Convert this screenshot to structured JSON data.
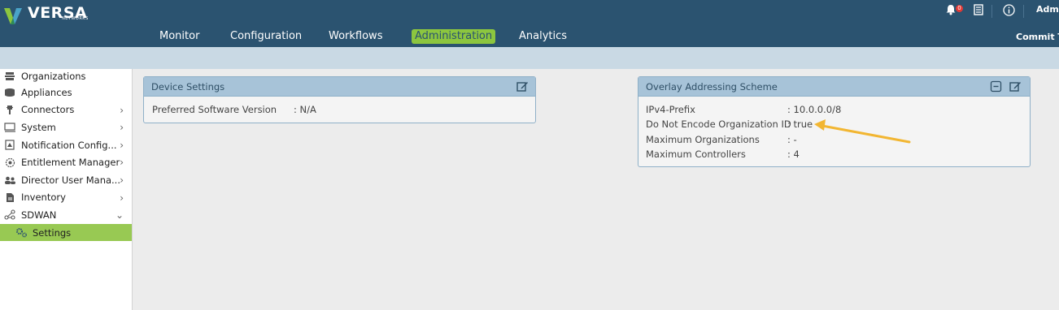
{
  "header": {
    "logo_text": "VERSA",
    "logo_subtext": "NETWORKS",
    "nav": [
      "Monitor",
      "Configuration",
      "Workflows",
      "Administration",
      "Analytics"
    ],
    "active_nav": "Administration",
    "notification_count": "0",
    "user_label": "Admi",
    "commit_label": "Commit Te"
  },
  "sidebar": {
    "items": [
      {
        "label": "Organizations",
        "icon": "organizations-icon"
      },
      {
        "label": "Appliances",
        "icon": "appliances-icon"
      },
      {
        "label": "Connectors",
        "icon": "connectors-icon",
        "expandable": true
      },
      {
        "label": "System",
        "icon": "system-icon",
        "expandable": true
      },
      {
        "label": "Notification Config...",
        "icon": "notification-icon",
        "expandable": true
      },
      {
        "label": "Entitlement Manager",
        "icon": "entitlement-icon",
        "expandable": true
      },
      {
        "label": "Director User Mana...",
        "icon": "users-icon",
        "expandable": true
      },
      {
        "label": "Inventory",
        "icon": "inventory-icon",
        "expandable": true
      },
      {
        "label": "SDWAN",
        "icon": "sdwan-icon",
        "expanded": true
      },
      {
        "label": "Settings",
        "icon": "settings-icon",
        "active": true
      }
    ]
  },
  "device_settings": {
    "title": "Device Settings",
    "rows": [
      {
        "label": "Preferred Software Version",
        "value": ": N/A"
      }
    ]
  },
  "overlay": {
    "title": "Overlay Addressing Scheme",
    "rows": [
      {
        "label": "IPv4-Prefix",
        "value": ": 10.0.0.0/8"
      },
      {
        "label": "Do Not Encode Organization ID",
        "value": ": true"
      },
      {
        "label": "Maximum Organizations",
        "value": ": -"
      },
      {
        "label": "Maximum Controllers",
        "value": ": 4"
      }
    ]
  },
  "colors": {
    "header_bg": "#2b5370",
    "accent_green": "#8cc63f",
    "panel_head": "#a7c3d8",
    "annotation_arrow": "#f2b632"
  }
}
